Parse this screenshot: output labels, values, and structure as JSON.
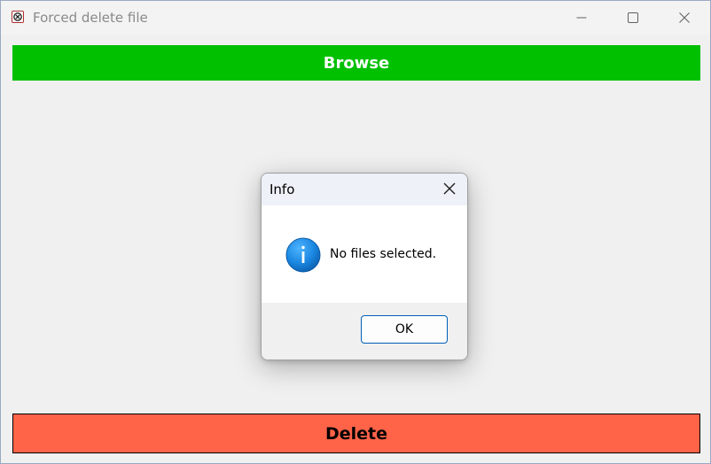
{
  "window": {
    "title": "Forced delete file",
    "app_icon": "forced-delete-app-icon",
    "controls": {
      "minimize_icon": "minimize-icon",
      "maximize_icon": "maximize-icon",
      "close_icon": "close-icon"
    }
  },
  "toolbar": {
    "browse_label": "Browse",
    "browse_color": "#00c000"
  },
  "footer": {
    "delete_label": "Delete",
    "delete_color": "#ff6348"
  },
  "dialog": {
    "title": "Info",
    "close_icon": "close-icon",
    "icon": "info-icon",
    "message": "No files selected.",
    "ok_label": "OK",
    "accent": "#005fb8"
  }
}
